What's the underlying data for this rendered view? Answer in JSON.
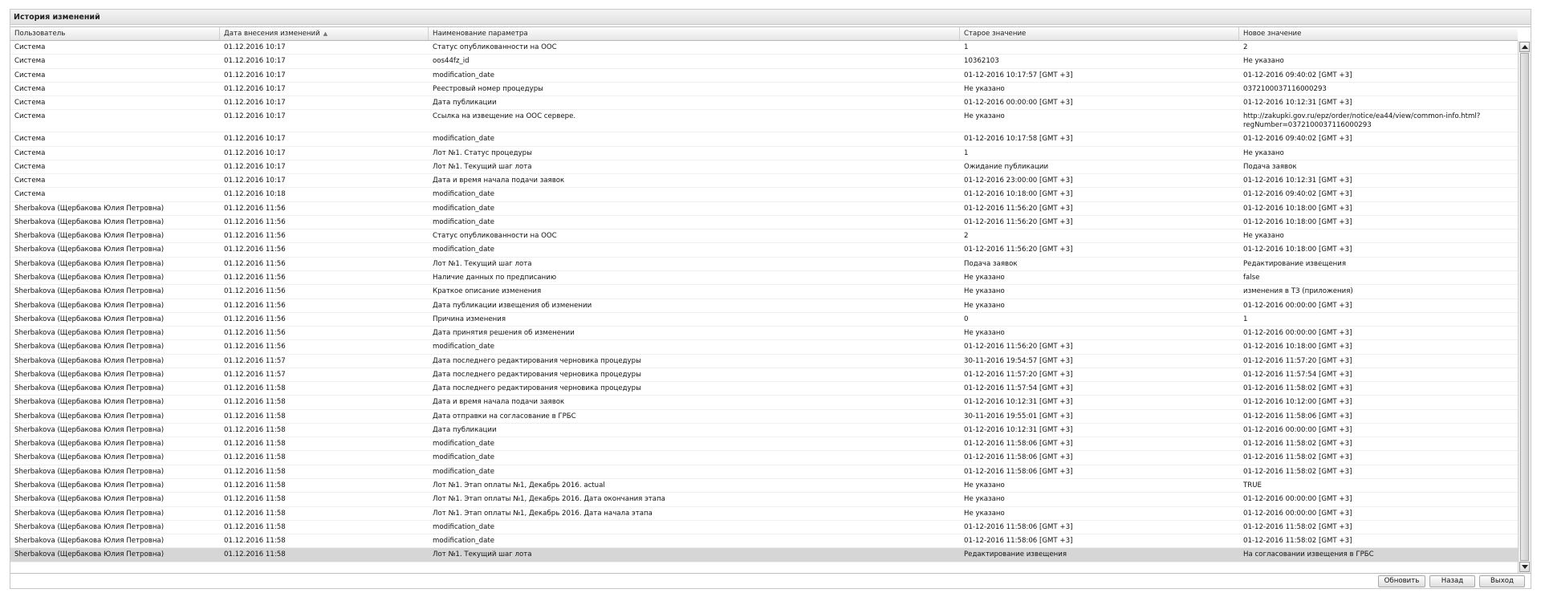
{
  "panel": {
    "title": "История изменений"
  },
  "grid": {
    "columns": [
      "Пользователь",
      "Дата внесения изменений",
      "Наименование параметра",
      "Старое значение",
      "Новое значение"
    ],
    "sort_indicator": "▲",
    "rows": [
      [
        "Система",
        "01.12.2016 10:17",
        "Статус опубликованности на ООС",
        "1",
        "2"
      ],
      [
        "Система",
        "01.12.2016 10:17",
        "oos44fz_id",
        "10362103",
        "Не указано"
      ],
      [
        "Система",
        "01.12.2016 10:17",
        "modification_date",
        "01-12-2016 10:17:57 [GMT +3]",
        "01-12-2016 09:40:02 [GMT +3]"
      ],
      [
        "Система",
        "01.12.2016 10:17",
        "Реестровый номер процедуры",
        "Не указано",
        "0372100037116000293"
      ],
      [
        "Система",
        "01.12.2016 10:17",
        "Дата публикации",
        "01-12-2016 00:00:00 [GMT +3]",
        "01-12-2016 10:12:31 [GMT +3]"
      ],
      [
        "Система",
        "01.12.2016 10:17",
        "Ссылка на извещение на ООС сервере.",
        "Не указано",
        "http://zakupki.gov.ru/epz/order/notice/ea44/view/common-info.html?regNumber=0372100037116000293"
      ],
      [
        "Система",
        "01.12.2016 10:17",
        "modification_date",
        "01-12-2016 10:17:58 [GMT +3]",
        "01-12-2016 09:40:02 [GMT +3]"
      ],
      [
        "Система",
        "01.12.2016 10:17",
        "Лот №1. Статус процедуры",
        "1",
        "Не указано"
      ],
      [
        "Система",
        "01.12.2016 10:17",
        "Лот №1. Текущий шаг лота",
        "Ожидание публикации",
        "Подача заявок"
      ],
      [
        "Система",
        "01.12.2016 10:17",
        "Дата и время начала подачи заявок",
        "01-12-2016 23:00:00 [GMT +3]",
        "01-12-2016 10:12:31 [GMT +3]"
      ],
      [
        "Система",
        "01.12.2016 10:18",
        "modification_date",
        "01-12-2016 10:18:00 [GMT +3]",
        "01-12-2016 09:40:02 [GMT +3]"
      ],
      [
        "Sherbakova (Щербакова Юлия Петровна)",
        "01.12.2016 11:56",
        "modification_date",
        "01-12-2016 11:56:20 [GMT +3]",
        "01-12-2016 10:18:00 [GMT +3]"
      ],
      [
        "Sherbakova (Щербакова Юлия Петровна)",
        "01.12.2016 11:56",
        "modification_date",
        "01-12-2016 11:56:20 [GMT +3]",
        "01-12-2016 10:18:00 [GMT +3]"
      ],
      [
        "Sherbakova (Щербакова Юлия Петровна)",
        "01.12.2016 11:56",
        "Статус опубликованности на ООС",
        "2",
        "Не указано"
      ],
      [
        "Sherbakova (Щербакова Юлия Петровна)",
        "01.12.2016 11:56",
        "modification_date",
        "01-12-2016 11:56:20 [GMT +3]",
        "01-12-2016 10:18:00 [GMT +3]"
      ],
      [
        "Sherbakova (Щербакова Юлия Петровна)",
        "01.12.2016 11:56",
        "Лот №1. Текущий шаг лота",
        "Подача заявок",
        "Редактирование извещения"
      ],
      [
        "Sherbakova (Щербакова Юлия Петровна)",
        "01.12.2016 11:56",
        "Наличие данных по предписанию",
        "Не указано",
        "false"
      ],
      [
        "Sherbakova (Щербакова Юлия Петровна)",
        "01.12.2016 11:56",
        "Краткое описание изменения",
        "Не указано",
        "изменения в ТЗ (приложения)"
      ],
      [
        "Sherbakova (Щербакова Юлия Петровна)",
        "01.12.2016 11:56",
        "Дата публикации извещения об изменении",
        "Не указано",
        "01-12-2016 00:00:00 [GMT +3]"
      ],
      [
        "Sherbakova (Щербакова Юлия Петровна)",
        "01.12.2016 11:56",
        "Причина изменения",
        "0",
        "1"
      ],
      [
        "Sherbakova (Щербакова Юлия Петровна)",
        "01.12.2016 11:56",
        "Дата принятия решения об изменении",
        "Не указано",
        "01-12-2016 00:00:00 [GMT +3]"
      ],
      [
        "Sherbakova (Щербакова Юлия Петровна)",
        "01.12.2016 11:56",
        "modification_date",
        "01-12-2016 11:56:20 [GMT +3]",
        "01-12-2016 10:18:00 [GMT +3]"
      ],
      [
        "Sherbakova (Щербакова Юлия Петровна)",
        "01.12.2016 11:57",
        "Дата последнего редактирования черновика процедуры",
        "30-11-2016 19:54:57 [GMT +3]",
        "01-12-2016 11:57:20 [GMT +3]"
      ],
      [
        "Sherbakova (Щербакова Юлия Петровна)",
        "01.12.2016 11:57",
        "Дата последнего редактирования черновика процедуры",
        "01-12-2016 11:57:20 [GMT +3]",
        "01-12-2016 11:57:54 [GMT +3]"
      ],
      [
        "Sherbakova (Щербакова Юлия Петровна)",
        "01.12.2016 11:58",
        "Дата последнего редактирования черновика процедуры",
        "01-12-2016 11:57:54 [GMT +3]",
        "01-12-2016 11:58:02 [GMT +3]"
      ],
      [
        "Sherbakova (Щербакова Юлия Петровна)",
        "01.12.2016 11:58",
        "Дата и время начала подачи заявок",
        "01-12-2016 10:12:31 [GMT +3]",
        "01-12-2016 10:12:00 [GMT +3]"
      ],
      [
        "Sherbakova (Щербакова Юлия Петровна)",
        "01.12.2016 11:58",
        "Дата отправки на согласование в ГРБС",
        "30-11-2016 19:55:01 [GMT +3]",
        "01-12-2016 11:58:06 [GMT +3]"
      ],
      [
        "Sherbakova (Щербакова Юлия Петровна)",
        "01.12.2016 11:58",
        "Дата публикации",
        "01-12-2016 10:12:31 [GMT +3]",
        "01-12-2016 00:00:00 [GMT +3]"
      ],
      [
        "Sherbakova (Щербакова Юлия Петровна)",
        "01.12.2016 11:58",
        "modification_date",
        "01-12-2016 11:58:06 [GMT +3]",
        "01-12-2016 11:58:02 [GMT +3]"
      ],
      [
        "Sherbakova (Щербакова Юлия Петровна)",
        "01.12.2016 11:58",
        "modification_date",
        "01-12-2016 11:58:06 [GMT +3]",
        "01-12-2016 11:58:02 [GMT +3]"
      ],
      [
        "Sherbakova (Щербакова Юлия Петровна)",
        "01.12.2016 11:58",
        "modification_date",
        "01-12-2016 11:58:06 [GMT +3]",
        "01-12-2016 11:58:02 [GMT +3]"
      ],
      [
        "Sherbakova (Щербакова Юлия Петровна)",
        "01.12.2016 11:58",
        "Лот №1. Этап оплаты №1, Декабрь 2016. actual",
        "Не указано",
        "TRUE"
      ],
      [
        "Sherbakova (Щербакова Юлия Петровна)",
        "01.12.2016 11:58",
        "Лот №1. Этап оплаты №1, Декабрь 2016. Дата окончания этапа",
        "Не указано",
        "01-12-2016 00:00:00 [GMT +3]"
      ],
      [
        "Sherbakova (Щербакова Юлия Петровна)",
        "01.12.2016 11:58",
        "Лот №1. Этап оплаты №1, Декабрь 2016. Дата начала этапа",
        "Не указано",
        "01-12-2016 00:00:00 [GMT +3]"
      ],
      [
        "Sherbakova (Щербакова Юлия Петровна)",
        "01.12.2016 11:58",
        "modification_date",
        "01-12-2016 11:58:06 [GMT +3]",
        "01-12-2016 11:58:02 [GMT +3]"
      ],
      [
        "Sherbakova (Щербакова Юлия Петровна)",
        "01.12.2016 11:58",
        "modification_date",
        "01-12-2016 11:58:06 [GMT +3]",
        "01-12-2016 11:58:02 [GMT +3]"
      ],
      [
        "Sherbakova (Щербакова Юлия Петровна)",
        "01.12.2016 11:58",
        "Лот №1. Текущий шаг лота",
        "Редактирование извещения",
        "На согласовании извещения в ГРБС"
      ]
    ],
    "selected_row": 36
  },
  "footer": {
    "refresh_label": "Обновить",
    "back_label": "Назад",
    "exit_label": "Выход"
  }
}
